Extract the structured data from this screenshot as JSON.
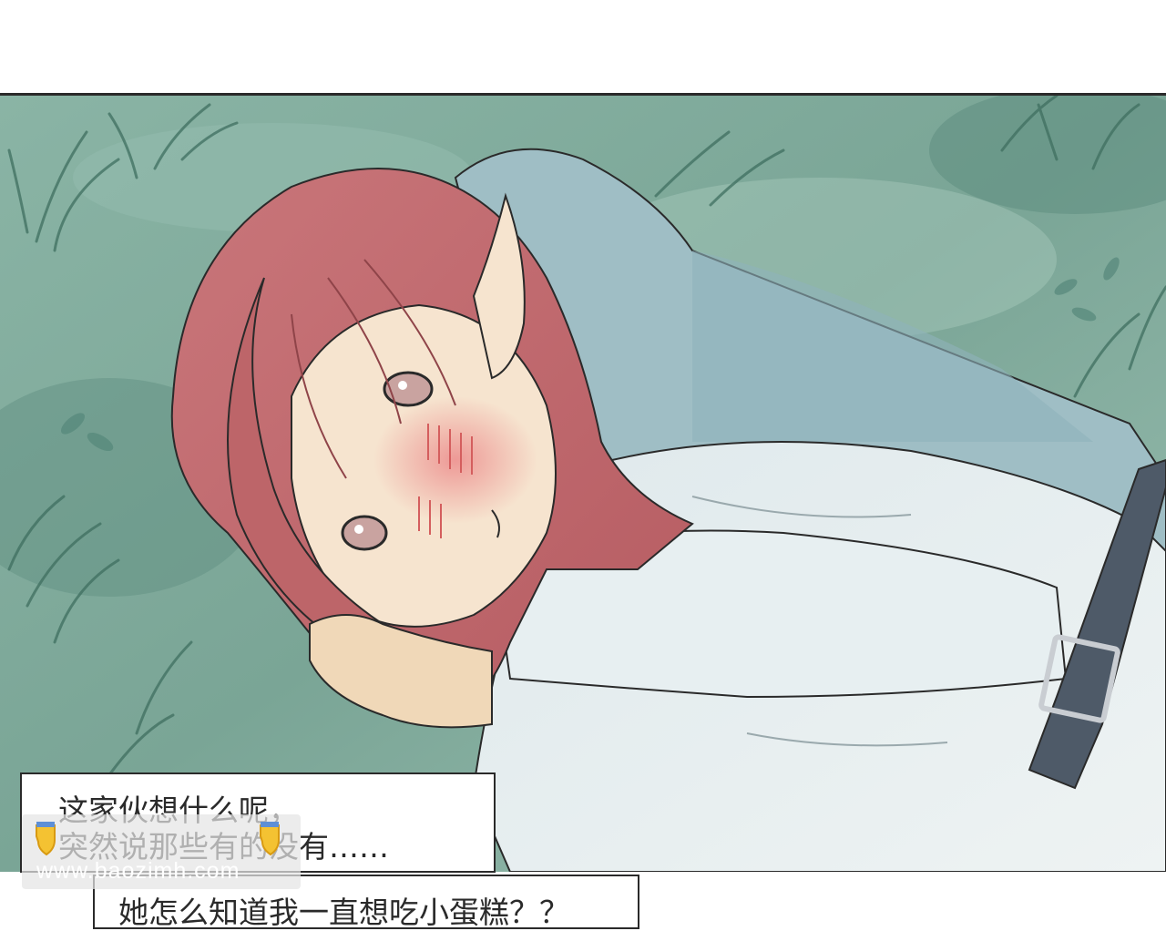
{
  "page": {
    "background": "#ffffff"
  },
  "colors": {
    "grass": "#7fa89b",
    "grass_dark": "#4f7e6e",
    "hair": "#c46a6e",
    "skin": "#f6e4cf",
    "blush": "#e98a8a",
    "shirt": "#e4ecee",
    "vest": "#9dbdc4",
    "belt": "#4e5a68",
    "ink": "#2a2a2a"
  },
  "captions": [
    {
      "lines": [
        "这家伙想什么呢，",
        "突然说那些有的没有……"
      ]
    },
    {
      "lines": [
        "她怎么知道我一直想吃小蛋糕？？"
      ]
    }
  ],
  "watermark": {
    "text": "www.baozimh.com",
    "icon": "hand-pointing-down-icon"
  }
}
